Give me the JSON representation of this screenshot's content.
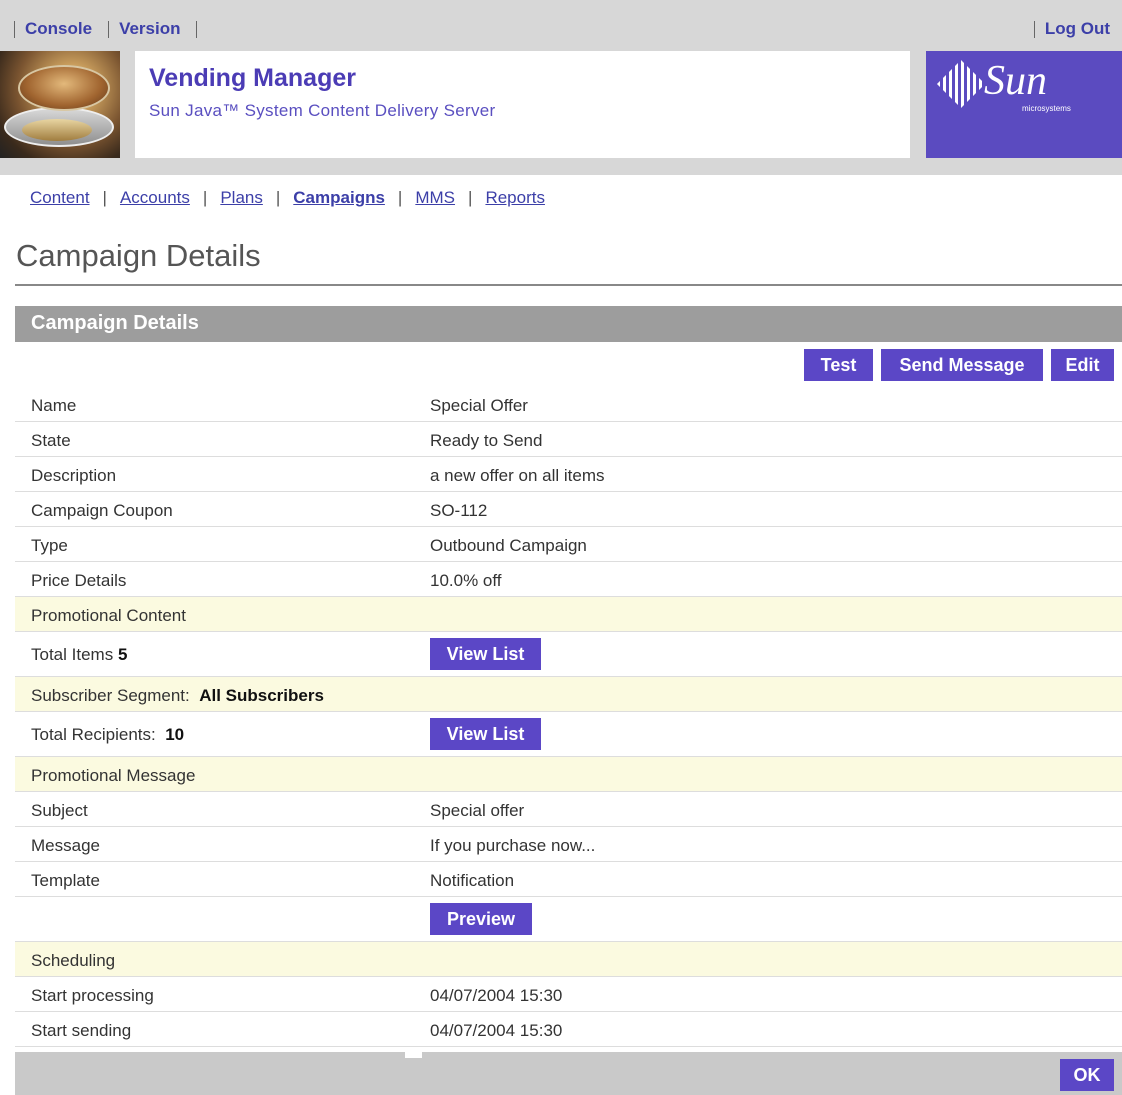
{
  "header": {
    "links": [
      "Console",
      "Version"
    ],
    "logout": "Log Out",
    "app_title": "Vending Manager",
    "app_subtitle": "Sun Java™ System Content Delivery Server",
    "logo_text": "Sun",
    "logo_sub": "microsystems"
  },
  "nav": {
    "tabs": [
      "Content",
      "Accounts",
      "Plans",
      "Campaigns",
      "MMS",
      "Reports"
    ],
    "active": "Campaigns"
  },
  "page_title": "Campaign Details",
  "panel": {
    "title": "Campaign Details",
    "buttons": {
      "test": "Test",
      "send": "Send Message",
      "edit": "Edit"
    },
    "name_label": "Name",
    "name_value": "Special Offer",
    "state_label": "State",
    "state_value": "Ready to Send",
    "desc_label": "Description",
    "desc_value": "a new offer on all items",
    "coupon_label": "Campaign Coupon",
    "coupon_value": "SO-112",
    "type_label": "Type",
    "type_value": "Outbound Campaign",
    "price_label": "Price Details",
    "price_value": "10.0% off",
    "promo_content_section": "Promotional Content",
    "total_items_label": "Total Items",
    "total_items_value": "5",
    "view_list": "View List",
    "segment_label": "Subscriber Segment:",
    "segment_value": "All Subscribers",
    "recipients_label": "Total Recipients:",
    "recipients_value": "10",
    "promo_message_section": "Promotional Message",
    "subject_label": "Subject",
    "subject_value": "Special offer",
    "message_label": "Message",
    "message_value": "If you purchase now...",
    "template_label": "Template",
    "template_value": "Notification",
    "preview": "Preview",
    "scheduling_section": "Scheduling",
    "start_processing_label": "Start processing",
    "start_processing_value": "04/07/2004 15:30",
    "start_sending_label": "Start sending",
    "start_sending_value": "04/07/2004 15:30",
    "ok": "OK"
  },
  "colors": {
    "accent": "#5b47c6",
    "link": "#3c3fa8",
    "section_bg": "#fbfae0",
    "panel_head": "#9d9d9d"
  }
}
